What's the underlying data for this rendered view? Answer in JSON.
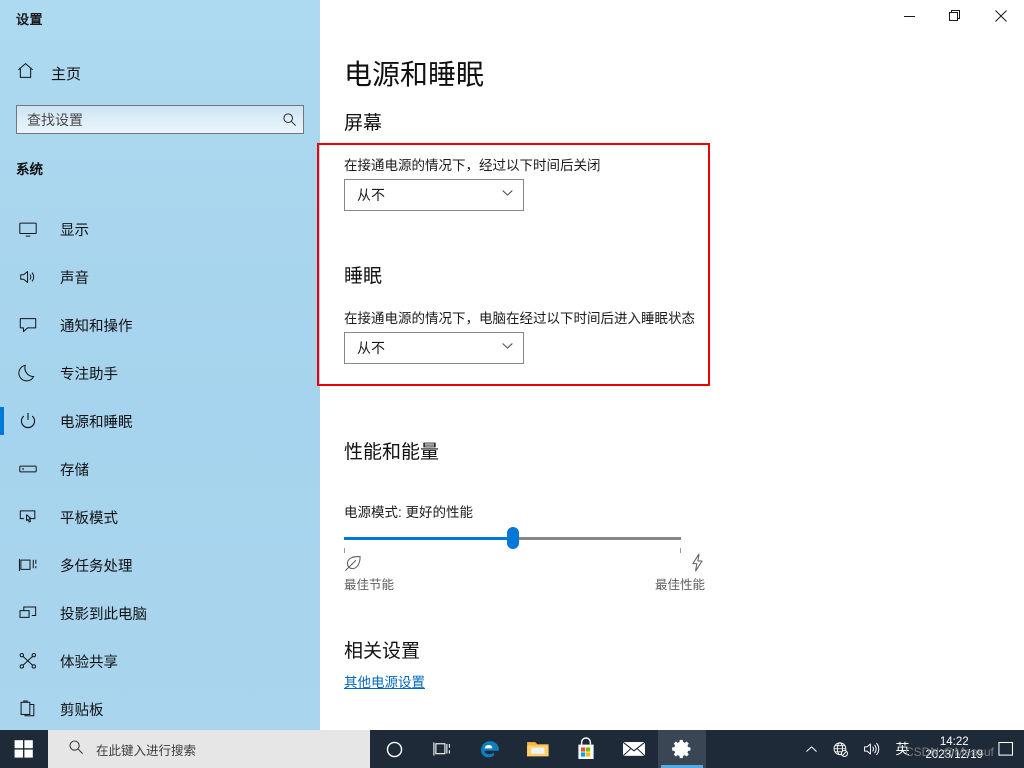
{
  "window": {
    "app_title": "设置",
    "controls": {
      "minimize": "最小化",
      "restore": "还原",
      "close": "关闭"
    }
  },
  "sidebar": {
    "home_label": "主页",
    "home_icon": "home-icon",
    "search": {
      "placeholder": "查找设置",
      "value": "",
      "icon": "search-icon"
    },
    "group_header": "系统",
    "items": [
      {
        "label": "显示",
        "icon": "monitor-icon",
        "selected": false
      },
      {
        "label": "声音",
        "icon": "speaker-icon",
        "selected": false
      },
      {
        "label": "通知和操作",
        "icon": "chat-bubble-icon",
        "selected": false
      },
      {
        "label": "专注助手",
        "icon": "moon-icon",
        "selected": false
      },
      {
        "label": "电源和睡眠",
        "icon": "power-icon",
        "selected": true
      },
      {
        "label": "存储",
        "icon": "drive-icon",
        "selected": false
      },
      {
        "label": "平板模式",
        "icon": "tablet-icon",
        "selected": false
      },
      {
        "label": "多任务处理",
        "icon": "multitask-icon",
        "selected": false
      },
      {
        "label": "投影到此电脑",
        "icon": "project-icon",
        "selected": false
      },
      {
        "label": "体验共享",
        "icon": "share-icon",
        "selected": false
      },
      {
        "label": "剪贴板",
        "icon": "clipboard-icon",
        "selected": false
      }
    ]
  },
  "main": {
    "page_title": "电源和睡眠",
    "screen": {
      "heading": "屏幕",
      "description": "在接通电源的情况下，经过以下时间后关闭",
      "dropdown_value": "从不",
      "dropdown_icon": "chevron-down-icon"
    },
    "sleep": {
      "heading": "睡眠",
      "description": "在接通电源的情况下，电脑在经过以下时间后进入睡眠状态",
      "dropdown_value": "从不",
      "dropdown_icon": "chevron-down-icon"
    },
    "performance": {
      "heading": "性能和能量",
      "mode_label": "电源模式: 更好的性能",
      "slider_percent": 50,
      "left_caption": "最佳节能",
      "left_icon": "leaf-icon",
      "right_caption": "最佳性能",
      "right_icon": "lightning-icon"
    },
    "related": {
      "heading": "相关设置",
      "link_label": "其他电源设置"
    }
  },
  "annotation": {
    "color": "#ef0000"
  },
  "taskbar": {
    "start_icon": "windows-start-icon",
    "search_placeholder": "在此键入进行搜索",
    "search_icon": "search-icon",
    "items": [
      {
        "name": "cortana-icon",
        "active": false
      },
      {
        "name": "task-view-icon",
        "active": false
      },
      {
        "name": "edge-browser-icon",
        "active": false
      },
      {
        "name": "file-explorer-icon",
        "active": false
      },
      {
        "name": "microsoft-store-icon",
        "active": false
      },
      {
        "name": "mail-icon",
        "active": false
      },
      {
        "name": "settings-gear-icon",
        "active": true
      }
    ],
    "tray": {
      "overflow_icon": "chevron-up-icon",
      "network_icon": "globe-network-icon",
      "volume_icon": "volume-icon",
      "ime_label": "英",
      "time": "14:22",
      "date": "2023/12/19",
      "action_center_icon": "action-center-icon"
    }
  },
  "watermark": {
    "text": "CSDN @Measuf"
  },
  "colors": {
    "accent": "#0078d7",
    "sidebar": "#a9d5ee",
    "taskbar": "#1f2a38",
    "link": "#0067c0",
    "annotation": "#ef0000"
  }
}
